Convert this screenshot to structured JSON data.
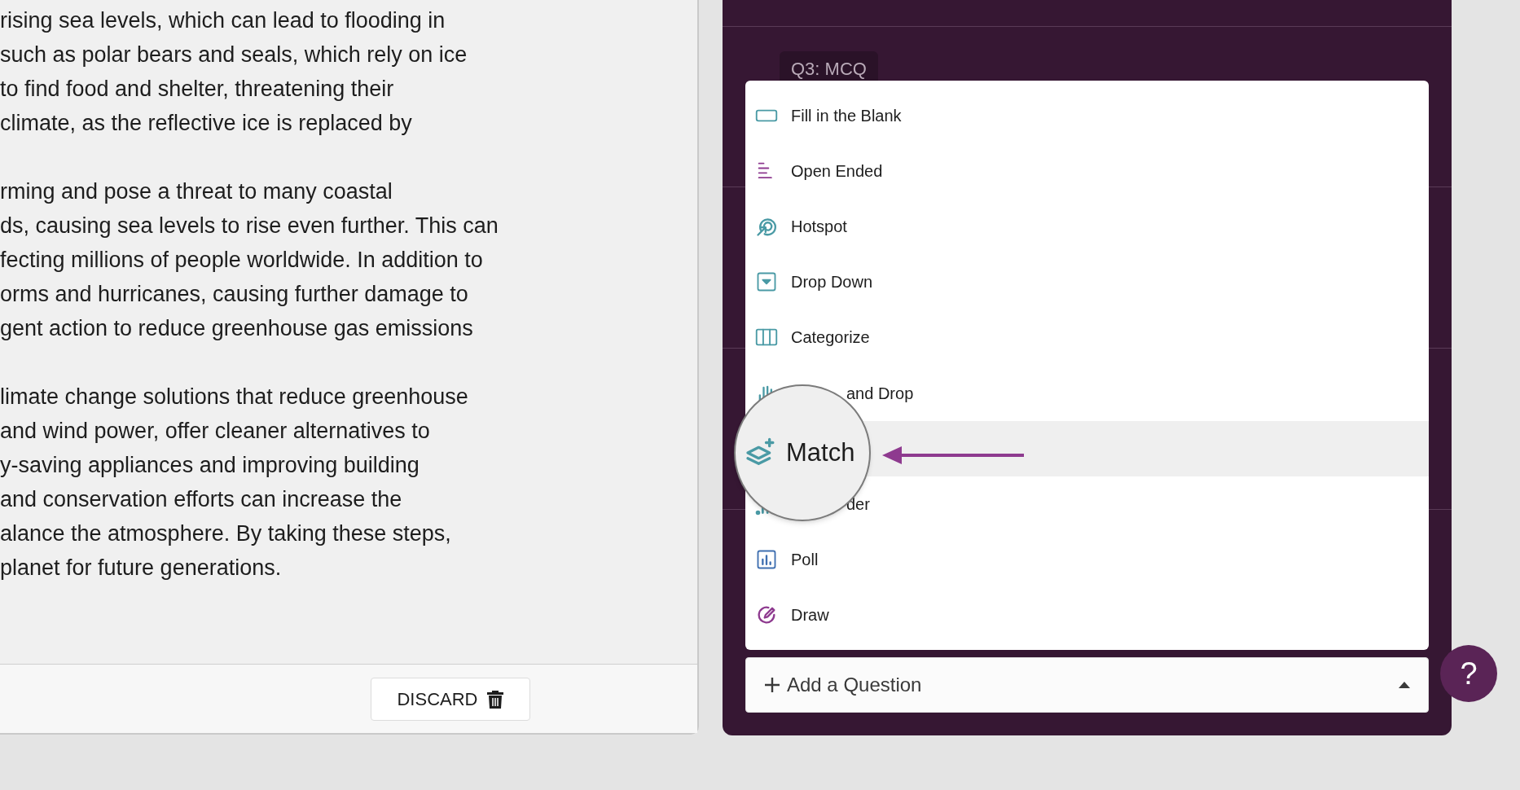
{
  "passage": {
    "paragraphs": [
      [
        "rising sea levels, which can lead to flooding in",
        "such as polar bears and seals, which rely on ice",
        "to find food and shelter, threatening their",
        "climate, as the reflective ice is replaced by"
      ],
      [
        "rming and pose a threat to many coastal",
        "ds, causing sea levels to rise even further. This can",
        "fecting millions of people worldwide. In addition to",
        "orms and hurricanes, causing further damage to",
        "gent action to reduce greenhouse gas emissions"
      ],
      [
        "limate change solutions that reduce greenhouse",
        "and wind power, offer cleaner alternatives to",
        "y-saving appliances and improving building",
        "and conservation efforts can increase the",
        "alance the atmosphere. By taking these steps,",
        "planet for future generations."
      ]
    ]
  },
  "footer": {
    "discard_button": "DISCARD"
  },
  "question_tag": "Q3: MCQ",
  "question_types": [
    {
      "kind": "fill_blank",
      "label": "Fill in the Blank",
      "selected": false,
      "covered": false
    },
    {
      "kind": "open_ended",
      "label": "Open Ended",
      "selected": false,
      "covered": false
    },
    {
      "kind": "hotspot",
      "label": "Hotspot",
      "selected": false,
      "covered": false
    },
    {
      "kind": "drop_down",
      "label": "Drop Down",
      "selected": false,
      "covered": false
    },
    {
      "kind": "categorize",
      "label": "Categorize",
      "selected": false,
      "covered": false
    },
    {
      "kind": "drag_drop",
      "label": "and Drop",
      "selected": false,
      "covered": true
    },
    {
      "kind": "match",
      "label": "Match",
      "selected": true,
      "magnified": true
    },
    {
      "kind": "slider",
      "label": "der",
      "selected": false,
      "covered": true
    },
    {
      "kind": "poll",
      "label": "Poll",
      "selected": false,
      "covered": false
    },
    {
      "kind": "draw",
      "label": "Draw",
      "selected": false,
      "covered": false
    }
  ],
  "add_question": {
    "label": "Add a Question",
    "expanded": true
  },
  "help_button": "?"
}
